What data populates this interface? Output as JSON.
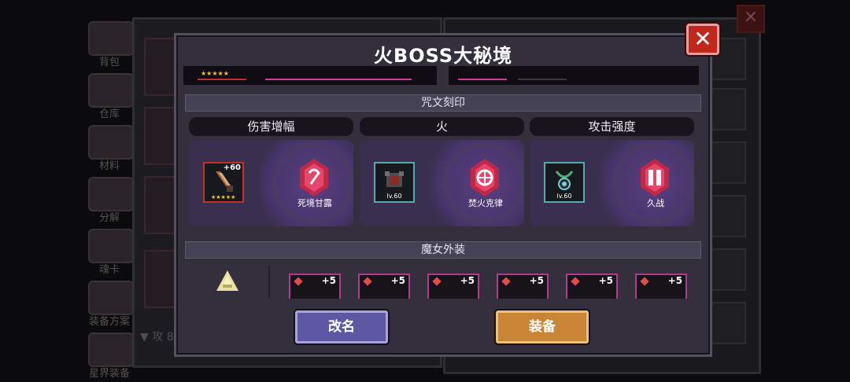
{
  "background": {
    "sidebar_items": [
      {
        "label": "背包"
      },
      {
        "label": "仓库"
      },
      {
        "label": "材料"
      },
      {
        "label": "分解"
      },
      {
        "label": "魂卡"
      },
      {
        "label": "装备方案"
      },
      {
        "label": "星界装备"
      }
    ],
    "stat_label": "攻",
    "stat_value": "81"
  },
  "dialog": {
    "title": "火BOSS大秘境",
    "close_icon": "close-x-icon",
    "rune_section_title": "咒文刻印",
    "runes": [
      {
        "header": "伤害增幅",
        "gear_badge": "+60",
        "gear_icon": "sword-icon",
        "rune_name": "死境甘露"
      },
      {
        "header": "火",
        "gear_badge": "lv.60",
        "gear_icon": "armor-icon",
        "rune_name": "焚火克律"
      },
      {
        "header": "攻击强度",
        "gear_badge": "lv.60",
        "gear_icon": "amulet-icon",
        "rune_name": "久战"
      }
    ],
    "costume_section_title": "魔女外装",
    "costume_badges": [
      "+5",
      "+5",
      "+5",
      "+5",
      "+5",
      "+5"
    ],
    "rename_button": "改名",
    "equip_button": "装备"
  },
  "colors": {
    "dialog_bg": "#332f3d",
    "rename_btn": "#5d57a4",
    "equip_btn": "#c88536",
    "close_btn": "#c0281c",
    "rune_glow": "#d0305a"
  }
}
